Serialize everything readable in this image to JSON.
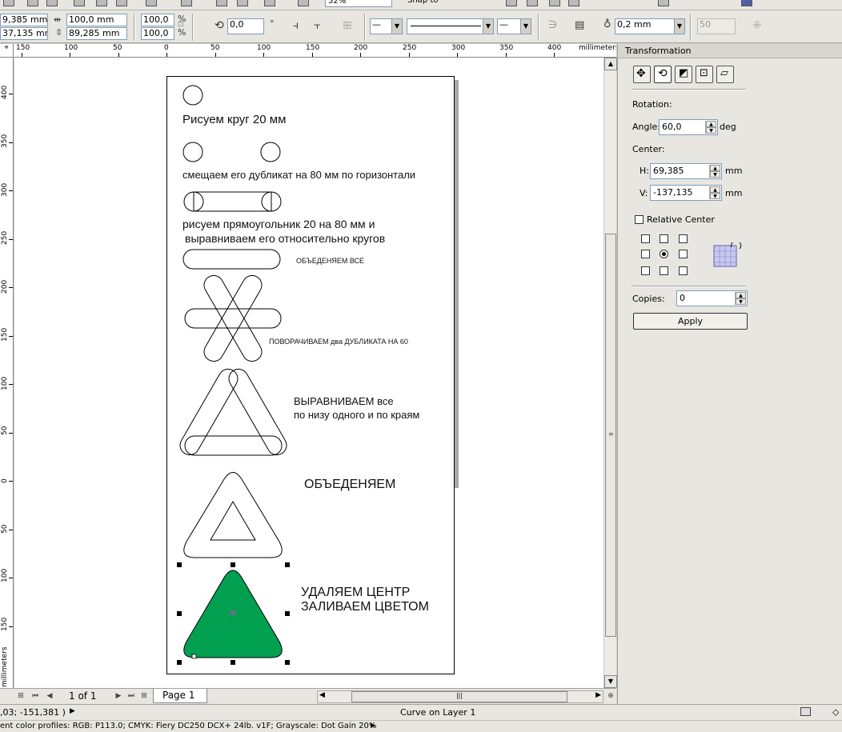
{
  "toolbar_top": {
    "zoom_value": "52%",
    "snap_label": "Snap to"
  },
  "propbar": {
    "x_pos": "9,385 mm",
    "y_pos": "37,135 mm",
    "width": "100,0 mm",
    "height": "89,285 mm",
    "scale_x": "100,0",
    "scale_y": "100,0",
    "percent": "%",
    "rotation": "0,0",
    "degree_symbol": "°",
    "outline_width": "0,2 mm",
    "disabled_value": "50"
  },
  "ruler": {
    "unit": "millimeters",
    "h_ticks": [
      "150",
      "100",
      "50",
      "0",
      "50",
      "100",
      "150",
      "200",
      "250",
      "300",
      "350",
      "400"
    ],
    "v_ticks": [
      "400",
      "350",
      "300",
      "250",
      "200",
      "150",
      "100",
      "50",
      "0",
      "50",
      "100",
      "150"
    ]
  },
  "drawing": {
    "step1": "Рисуем круг 20 мм",
    "step2": "смещаем его дубликат на 80 мм по горизонтали",
    "step3_line1": "рисуем прямоугольник 20 на 80 мм и",
    "step3_line2": "выравниваем его относительно кругов",
    "step4": "ОБЪЕДЕНЯЕМ ВСЕ",
    "step5": "ПОВОРАЧИВАЕМ  два ДУБЛИКАТА НА 60",
    "step6_line1": "ВЫРАВНИВАЕМ все",
    "step6_line2": "по низу одного и по краям",
    "step7": "ОБЪЕДЕНЯЕМ",
    "step8_line1": "УДАЛЯЕМ ЦЕНТР",
    "step8_line2": "ЗАЛИВАЕМ ЦВЕТОМ",
    "fill_color": "#00a050"
  },
  "nav": {
    "page_count": "1 of 1",
    "page_tab": "Page 1"
  },
  "status": {
    "coords": ",03; -151,381 )",
    "object_info": "Curve on Layer 1",
    "color_profiles": "ent color profiles: RGB: P113.0; CMYK: Fiery DC250 DCX+ 24lb. v1F; Grayscale: Dot Gain 20%"
  },
  "docker": {
    "title": "Transformation",
    "rotation_label": "Rotation:",
    "angle_label": "Angle:",
    "angle_value": "60,0",
    "angle_unit": "deg",
    "center_label": "Center:",
    "h_label": "H:",
    "h_value": "69,385",
    "v_label": "V:",
    "v_value": "-137,135",
    "unit_mm": "mm",
    "relative_center": "Relative Center",
    "copies_label": "Copies:",
    "copies_value": "0",
    "apply_label": "Apply"
  }
}
